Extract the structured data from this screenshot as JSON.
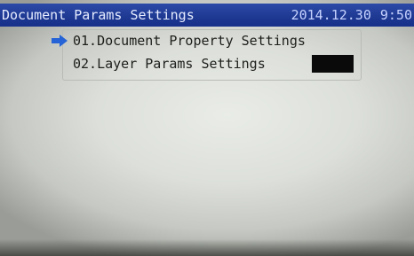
{
  "titlebar": {
    "title": "Document Params Settings",
    "date": "2014.12.30",
    "time": "9:50"
  },
  "menu": {
    "items": [
      {
        "label": "01.Document Property Settings",
        "selected": true
      },
      {
        "label": "02.Layer Params Settings",
        "selected": false
      }
    ]
  },
  "colors": {
    "titlebar_bg": "#1f3a93",
    "arrow": "#2563d6",
    "value_box": "#0a0a0a"
  }
}
